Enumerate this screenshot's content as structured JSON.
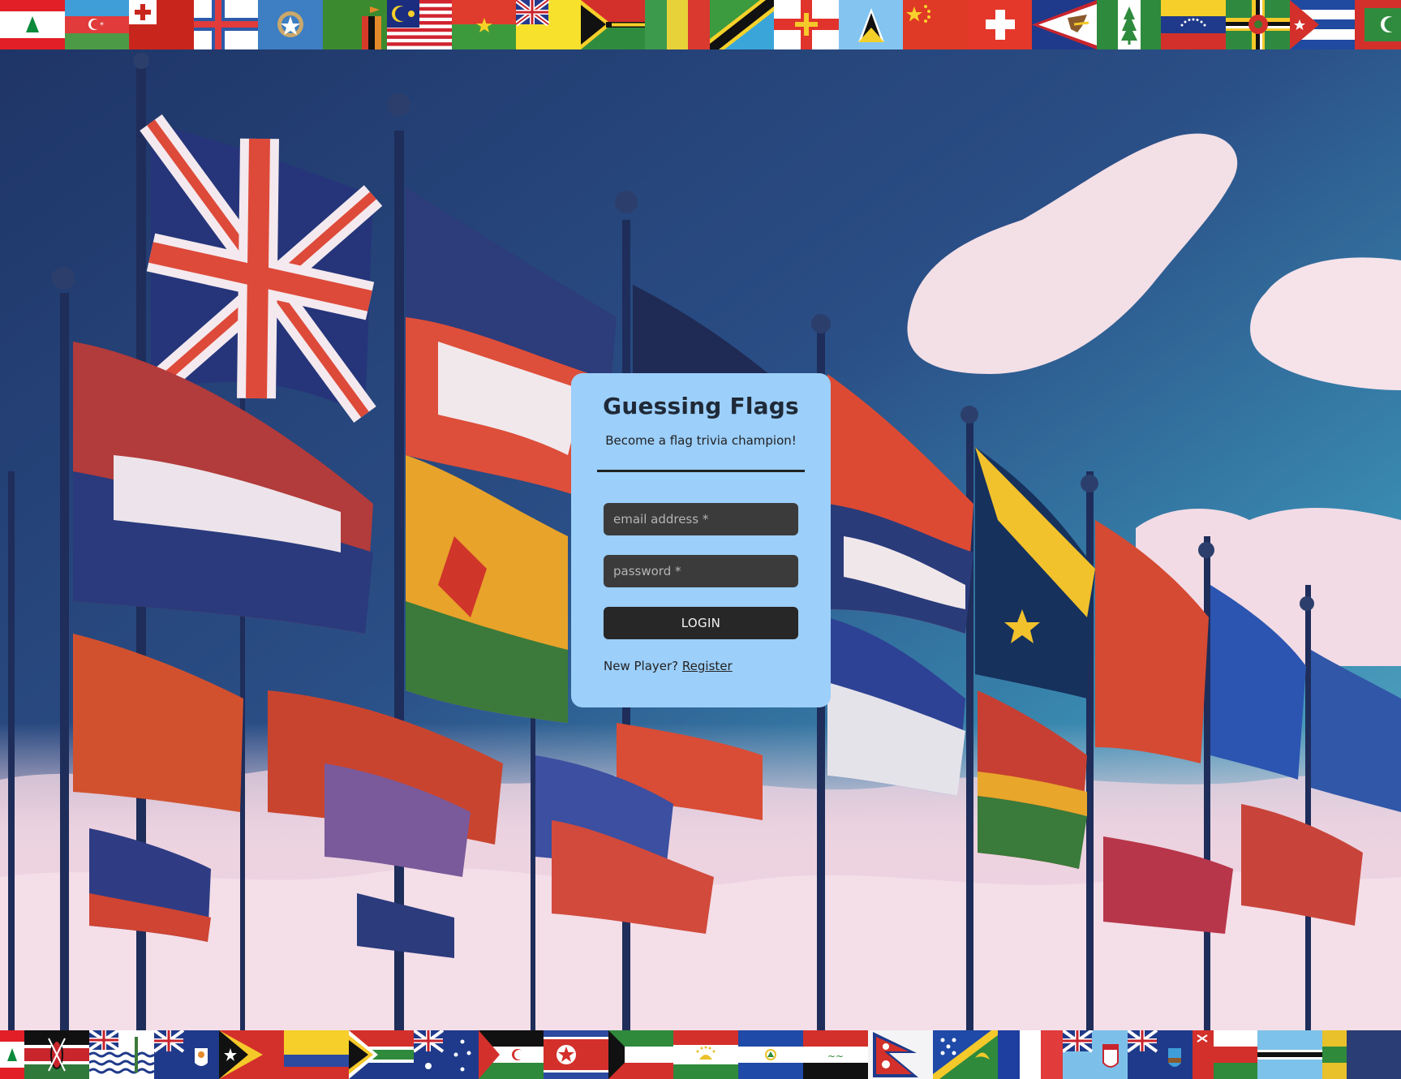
{
  "app": {
    "title": "Guessing Flags",
    "subtitle": "Become a flag trivia champion!"
  },
  "login": {
    "email_placeholder": "email address *",
    "password_placeholder": "password *",
    "login_label": "LOGIN",
    "new_player_text": "New Player?",
    "register_label": "Register"
  },
  "theme": {
    "card_bg": "#9ccffa",
    "field_bg": "#3b3b3b",
    "button_bg": "#272727"
  },
  "flags": {
    "top": [
      "lebanon",
      "azerbaijan",
      "tonga",
      "faroe-islands",
      "northern-mariana-islands",
      "zambia",
      "malaysia",
      "burkina-faso",
      "montserrat",
      "vanuatu",
      "guinea",
      "tanzania",
      "guernsey",
      "saint-lucia",
      "china",
      "switzerland",
      "american-samoa",
      "norfolk-island",
      "venezuela",
      "dominica",
      "cuba",
      "maldives"
    ],
    "bottom": [
      "lebanon",
      "kenya",
      "british-indian-ocean-territory",
      "anguilla",
      "timor-leste",
      "colombia",
      "south-africa",
      "australia",
      "western-sahara",
      "north-korea",
      "kuwait",
      "tajikistan",
      "el-salvador",
      "iraq",
      "nepal",
      "solomon-islands",
      "france",
      "fiji",
      "montserrat",
      "oman",
      "botswana"
    ]
  }
}
